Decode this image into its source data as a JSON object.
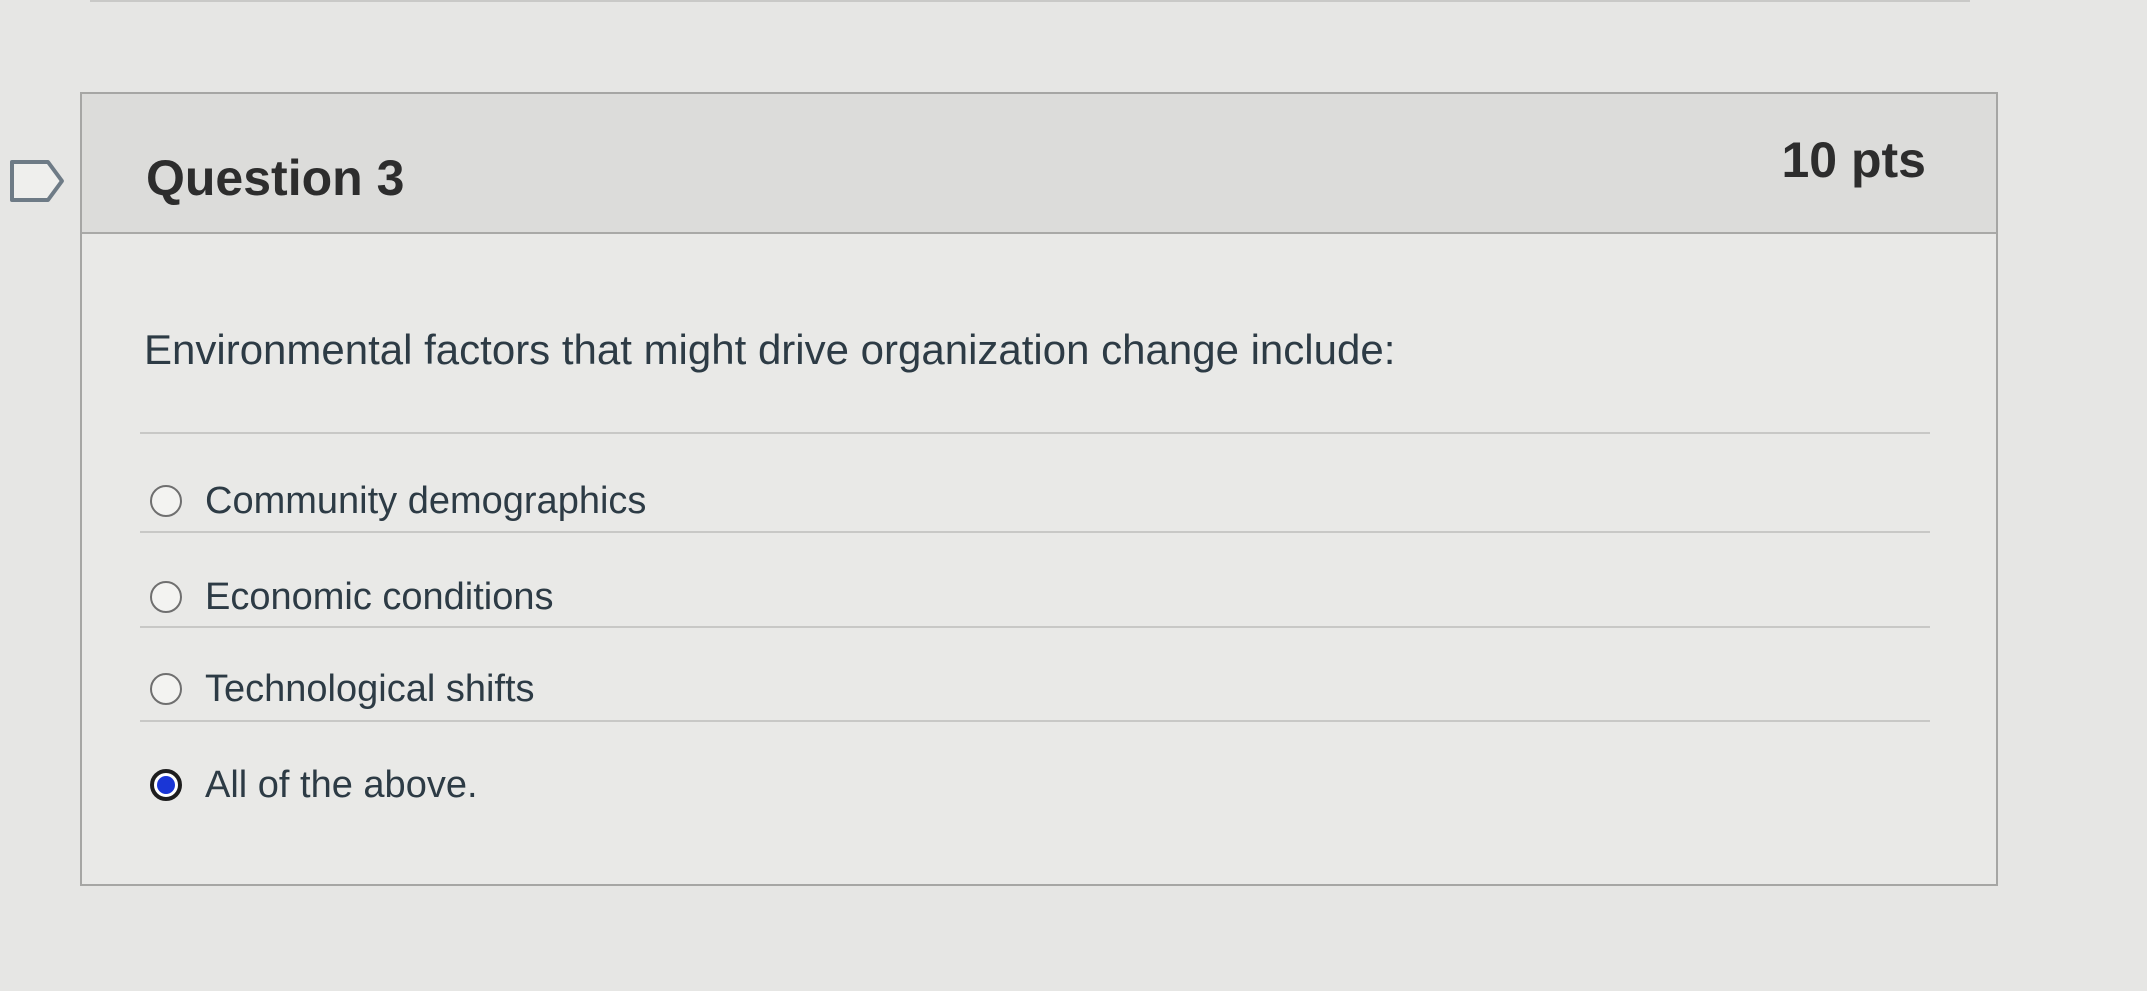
{
  "question": {
    "title": "Question 3",
    "points": "10 pts",
    "text": "Environmental factors that might drive organization change include:",
    "answers": [
      {
        "label": "Community demographics",
        "selected": false
      },
      {
        "label": "Economic conditions",
        "selected": false
      },
      {
        "label": "Technological shifts",
        "selected": false
      },
      {
        "label": "All of the above.",
        "selected": true
      }
    ]
  },
  "icons": {
    "flag": "flag-question-icon",
    "radio_selected_color": "#1a36d6"
  }
}
